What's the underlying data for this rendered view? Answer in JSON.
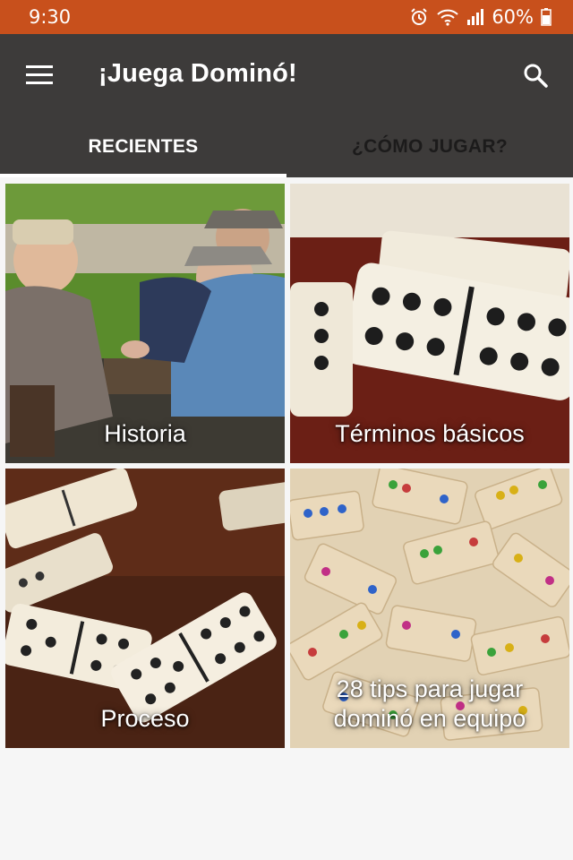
{
  "status_bar": {
    "time": "9:30",
    "battery_percent": "60%",
    "icons": [
      "alarm-icon",
      "wifi-icon",
      "signal-icon",
      "battery-icon"
    ]
  },
  "toolbar": {
    "title": "¡Juega Dominó!",
    "menu_icon": "hamburger-menu-icon",
    "search_icon": "search-icon"
  },
  "tabs": [
    {
      "label": "RECIENTES",
      "active": true
    },
    {
      "label": "¿CÓMO JUGAR?",
      "active": false
    }
  ],
  "cards": [
    {
      "label": "Historia"
    },
    {
      "label": "Términos básicos"
    },
    {
      "label": "Proceso"
    },
    {
      "label": "28 tips para jugar dominó en equipo"
    }
  ],
  "colors": {
    "status_bar": "#c8501c",
    "toolbar": "#3d3b3a",
    "tab_indicator": "#ffffff",
    "background": "#f6f6f6"
  }
}
